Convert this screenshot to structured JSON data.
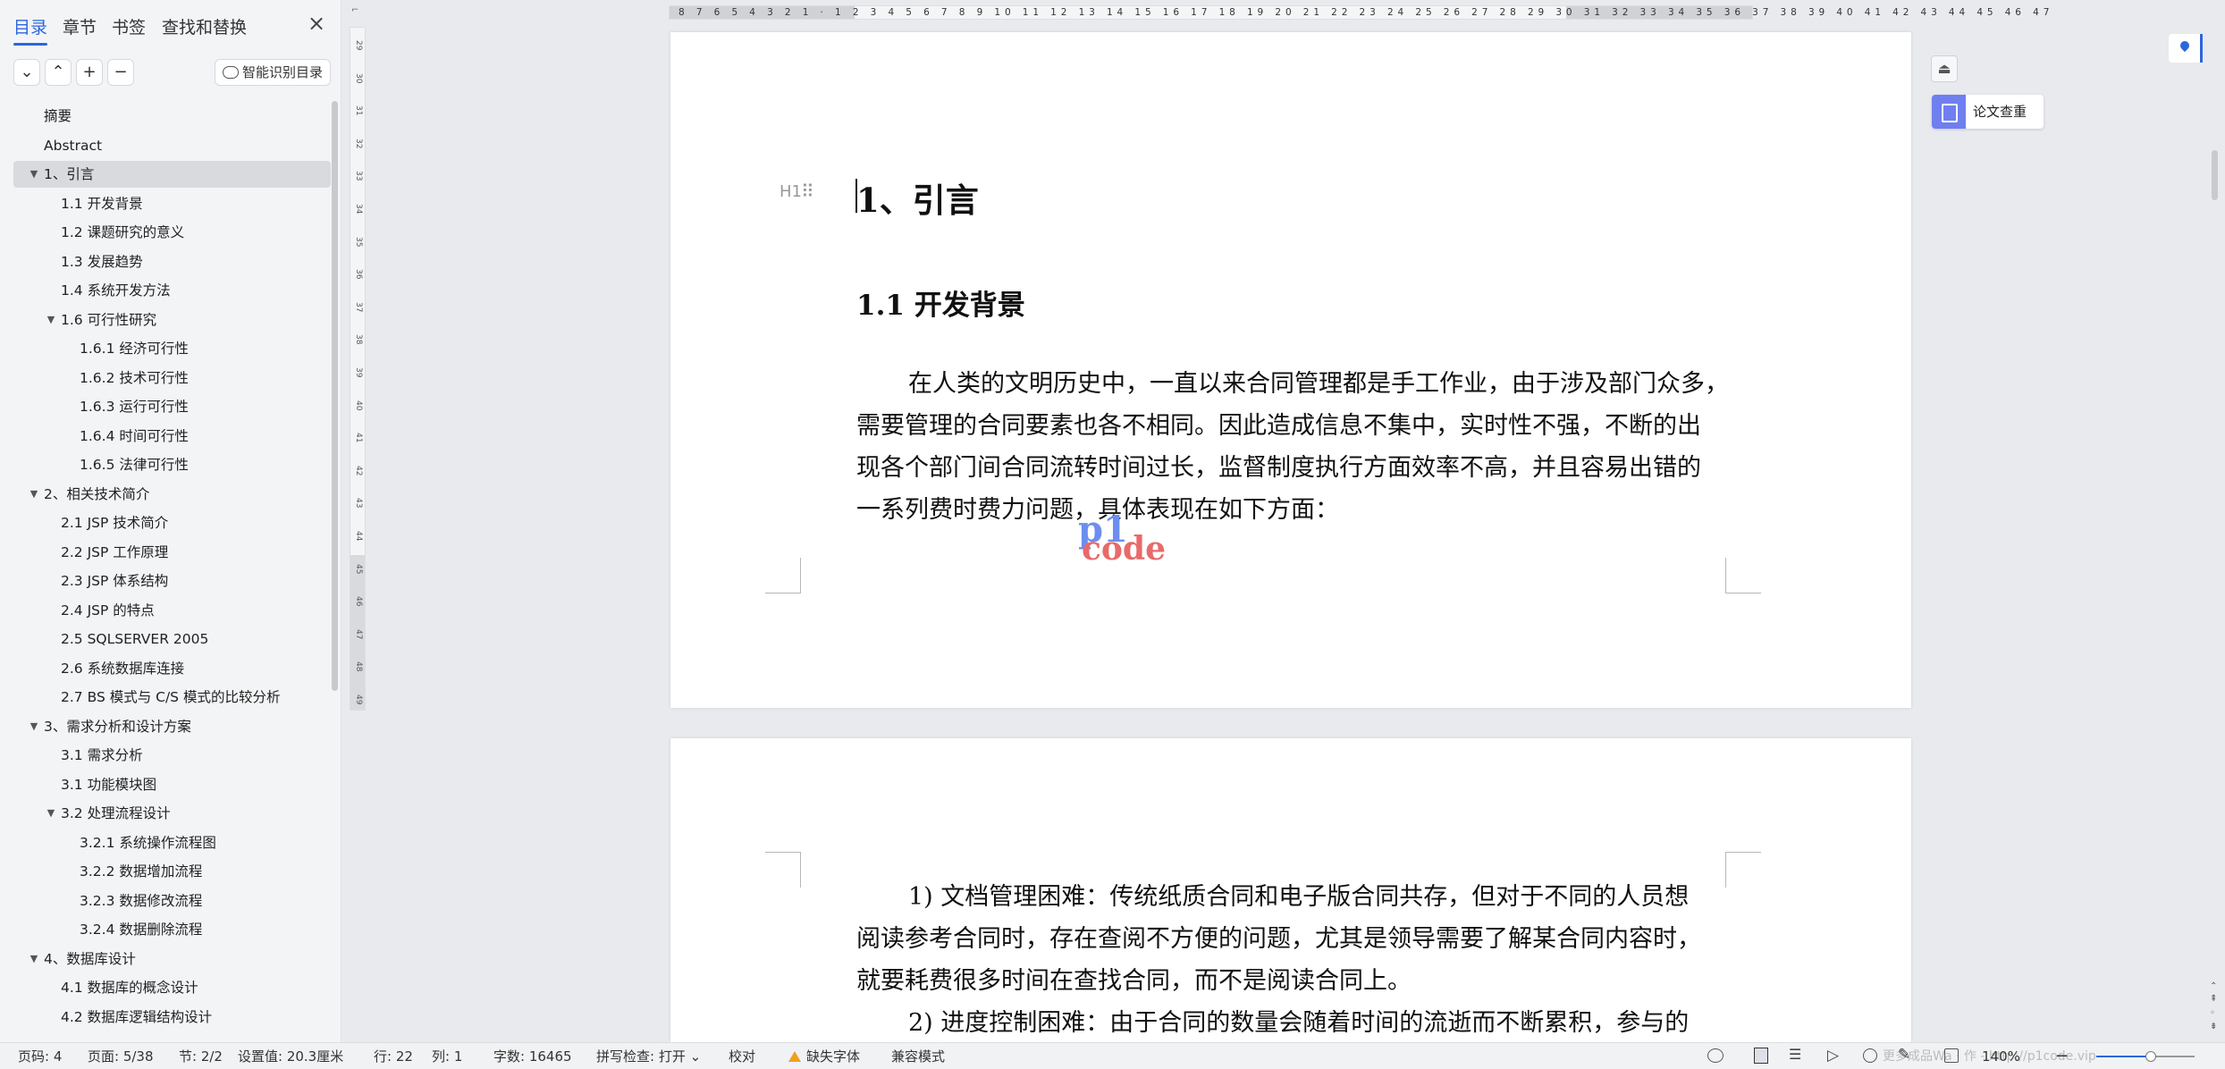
{
  "nav": {
    "tabs": [
      "目录",
      "章节",
      "书签",
      "查找和替换"
    ],
    "smart_button": "智能识别目录",
    "toc": [
      {
        "label": "摘要",
        "level": 0,
        "arrow": ""
      },
      {
        "label": "Abstract",
        "level": 0,
        "arrow": ""
      },
      {
        "label": "1、引言",
        "level": 0,
        "arrow": "▼",
        "selected": true
      },
      {
        "label": "1.1  开发背景",
        "level": 1,
        "arrow": ""
      },
      {
        "label": "1.2  课题研究的意义",
        "level": 1,
        "arrow": ""
      },
      {
        "label": "1.3  发展趋势",
        "level": 1,
        "arrow": ""
      },
      {
        "label": "1.4  系统开发方法",
        "level": 1,
        "arrow": ""
      },
      {
        "label": "1.6  可行性研究",
        "level": 1,
        "arrow": "▼"
      },
      {
        "label": "1.6.1  经济可行性",
        "level": 2,
        "arrow": ""
      },
      {
        "label": "1.6.2  技术可行性",
        "level": 2,
        "arrow": ""
      },
      {
        "label": "1.6.3 运行可行性",
        "level": 2,
        "arrow": ""
      },
      {
        "label": "1.6.4  时间可行性",
        "level": 2,
        "arrow": ""
      },
      {
        "label": "1.6.5  法律可行性",
        "level": 2,
        "arrow": ""
      },
      {
        "label": "2、相关技术简介",
        "level": 0,
        "arrow": "▼"
      },
      {
        "label": "2.1 JSP 技术简介",
        "level": 1,
        "arrow": ""
      },
      {
        "label": "2.2 JSP 工作原理",
        "level": 1,
        "arrow": ""
      },
      {
        "label": "2.3 JSP 体系结构",
        "level": 1,
        "arrow": ""
      },
      {
        "label": "2.4 JSP 的特点",
        "level": 1,
        "arrow": ""
      },
      {
        "label": "2.5 SQLSERVER 2005",
        "level": 1,
        "arrow": ""
      },
      {
        "label": "2.6 系统数据库连接",
        "level": 1,
        "arrow": ""
      },
      {
        "label": "2.7 BS 模式与 C/S 模式的比较分析",
        "level": 1,
        "arrow": ""
      },
      {
        "label": "3、需求分析和设计方案",
        "level": 0,
        "arrow": "▼"
      },
      {
        "label": "3.1  需求分析",
        "level": 1,
        "arrow": ""
      },
      {
        "label": "3.1  功能模块图",
        "level": 1,
        "arrow": ""
      },
      {
        "label": "3.2  处理流程设计",
        "level": 1,
        "arrow": "▼"
      },
      {
        "label": "3.2.1  系统操作流程图",
        "level": 2,
        "arrow": ""
      },
      {
        "label": "3.2.2  数据增加流程",
        "level": 2,
        "arrow": ""
      },
      {
        "label": "3.2.3  数据修改流程",
        "level": 2,
        "arrow": ""
      },
      {
        "label": "3.2.4  数据删除流程",
        "level": 2,
        "arrow": ""
      },
      {
        "label": "4、数据库设计",
        "level": 0,
        "arrow": "▼"
      },
      {
        "label": "4.1  数据库的概念设计",
        "level": 1,
        "arrow": ""
      },
      {
        "label": "4.2  数据库逻辑结构设计",
        "level": 1,
        "arrow": ""
      }
    ]
  },
  "ruler": {
    "h_numbers": "8 7 6 5 4 3 2 1 · 1 2 3 4 5 6 7 8 9 10 11 12 13 14 15 16 17 18 19 20 21 22 23 24 25 26 27 28 29 30 31 32 33 34 35 36 37 38 39 40 41 42 43 44 45 46 47",
    "v_numbers": [
      "29",
      "30",
      "31",
      "32",
      "33",
      "34",
      "35",
      "36",
      "37",
      "38",
      "39",
      "40",
      "41",
      "42",
      "43",
      "44",
      "45",
      "46",
      "47",
      "48",
      "49"
    ]
  },
  "document": {
    "heading1": "1、引言",
    "heading2": "1.1  开发背景",
    "heading_marker": "H1",
    "page1_lines": [
      "在人类的文明历史中，一直以来合同管理都是手工作业，由于涉及部门众多，",
      "需要管理的合同要素也各不相同。因此造成信息不集中，实时性不强，不断的出",
      "现各个部门间合同流转时间过长，监督制度执行方面效率不高，并且容易出错的",
      "一系列费时费力问题，具体表现在如下方面："
    ],
    "page2_lines": [
      "1)  文档管理困难：传统纸质合同和电子版合同共存，但对于不同的人员想",
      "阅读参考合同时，存在查阅不方便的问题，尤其是领导需要了解某合同内容时，",
      "就要耗费很多时间在查找合同，而不是阅读合同上。",
      "2)  进度控制困难：由于合同的数量会随着时间的流逝而不断累积，参与的"
    ],
    "watermark_top": "p1",
    "watermark_bottom": "code"
  },
  "side": {
    "check_label": "论文查重"
  },
  "status": {
    "page": "页码: 4",
    "pages": "页面: 5/38",
    "section": "节: 2/2",
    "setting": "设置值: 20.3厘米",
    "row": "行: 22",
    "col": "列: 1",
    "words": "字数: 16465",
    "spell": "拼写检查: 打开 ⌄",
    "proof": "校对",
    "missing_font": "缺失字体",
    "compat": "兼容模式",
    "zoom": "140%",
    "zoom_fraction": 0.55,
    "overlay_text": "更多成品Wa  ·  作 - http://p1code.vip"
  }
}
